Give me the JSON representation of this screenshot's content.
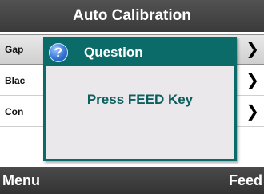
{
  "header": {
    "title": "Auto Calibration"
  },
  "menu": {
    "items": [
      {
        "label": "Gap",
        "chevron": "chevron-right-icon"
      },
      {
        "label": "Blac",
        "chevron": "chevron-right-icon"
      },
      {
        "label": "Con",
        "chevron": "chevron-right-icon"
      }
    ],
    "selected_index": 0
  },
  "dialog": {
    "icon": "question-icon",
    "icon_glyph": "?",
    "title": "Question",
    "message": "Press FEED Key"
  },
  "softkeys": {
    "left": "Menu",
    "right": "Feed"
  },
  "colors": {
    "accent": "#0b6b68",
    "dialog_bg": "#ebe8ec",
    "bar_bg": "#3a3a3a"
  }
}
